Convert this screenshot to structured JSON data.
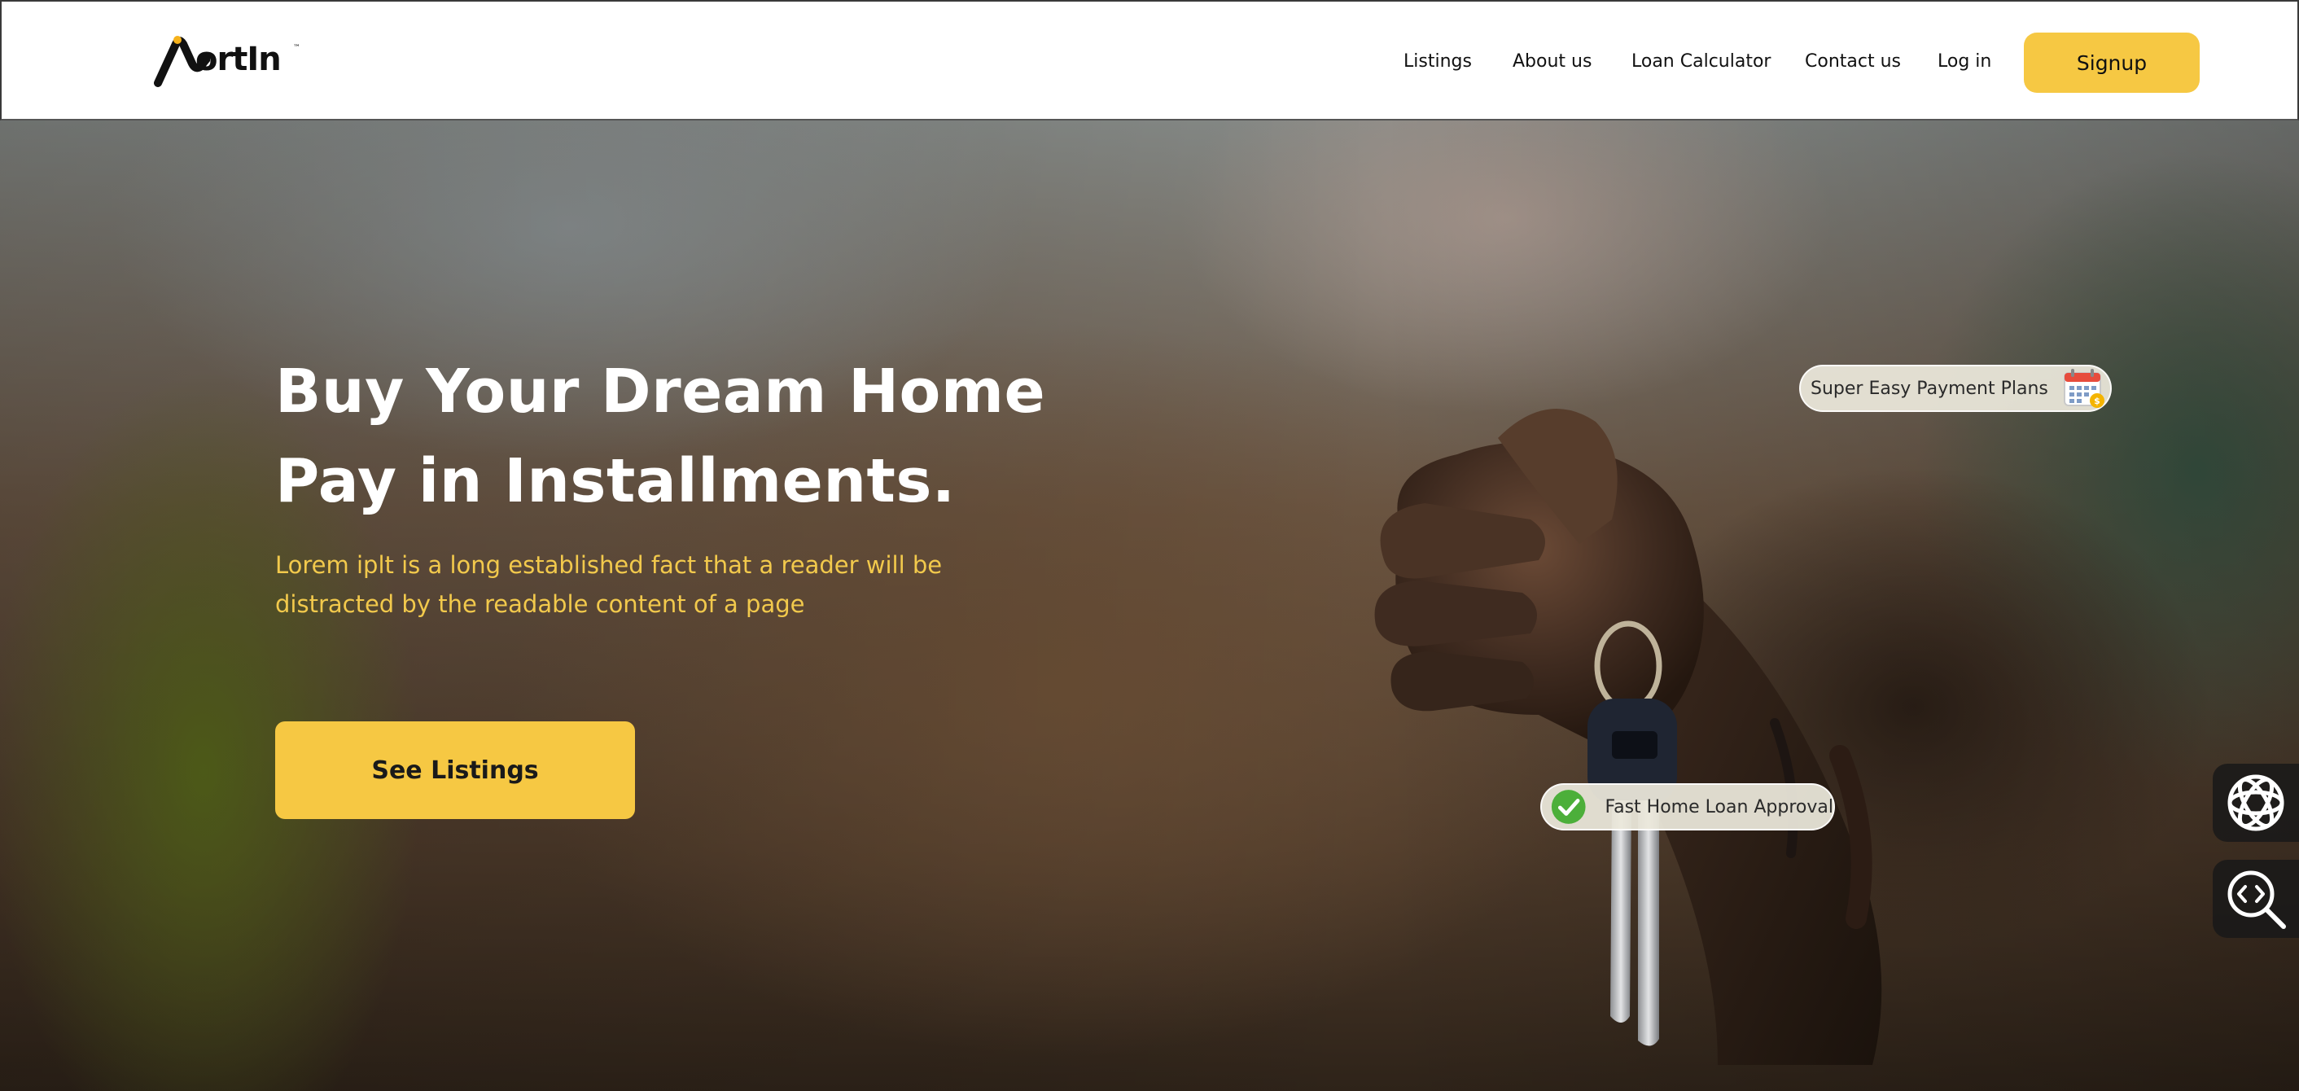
{
  "header": {
    "logo_text": "ortIn",
    "logo_tm": "™",
    "nav": {
      "listings": "Listings",
      "about": "About us",
      "loan_calculator": "Loan Calculator",
      "contact": "Contact us",
      "login": "Log in"
    },
    "signup_label": "Signup"
  },
  "hero": {
    "headline_line1": "Buy Your Dream Home",
    "headline_line2": "Pay in Installments.",
    "subtext_line1": "Lorem iplt is a long established fact that a reader will be",
    "subtext_line2": "distracted by the readable content of a page",
    "cta_label": "See Listings",
    "badge_payment": "Super Easy Payment Plans",
    "badge_loan": "Fast Home Loan Approval"
  },
  "side_tools": {
    "ai_icon": "ai-assistant-icon",
    "search_icon": "code-search-icon"
  },
  "colors": {
    "accent": "#f6c843",
    "subtext": "#f2c94c",
    "headline": "#ffffff"
  }
}
